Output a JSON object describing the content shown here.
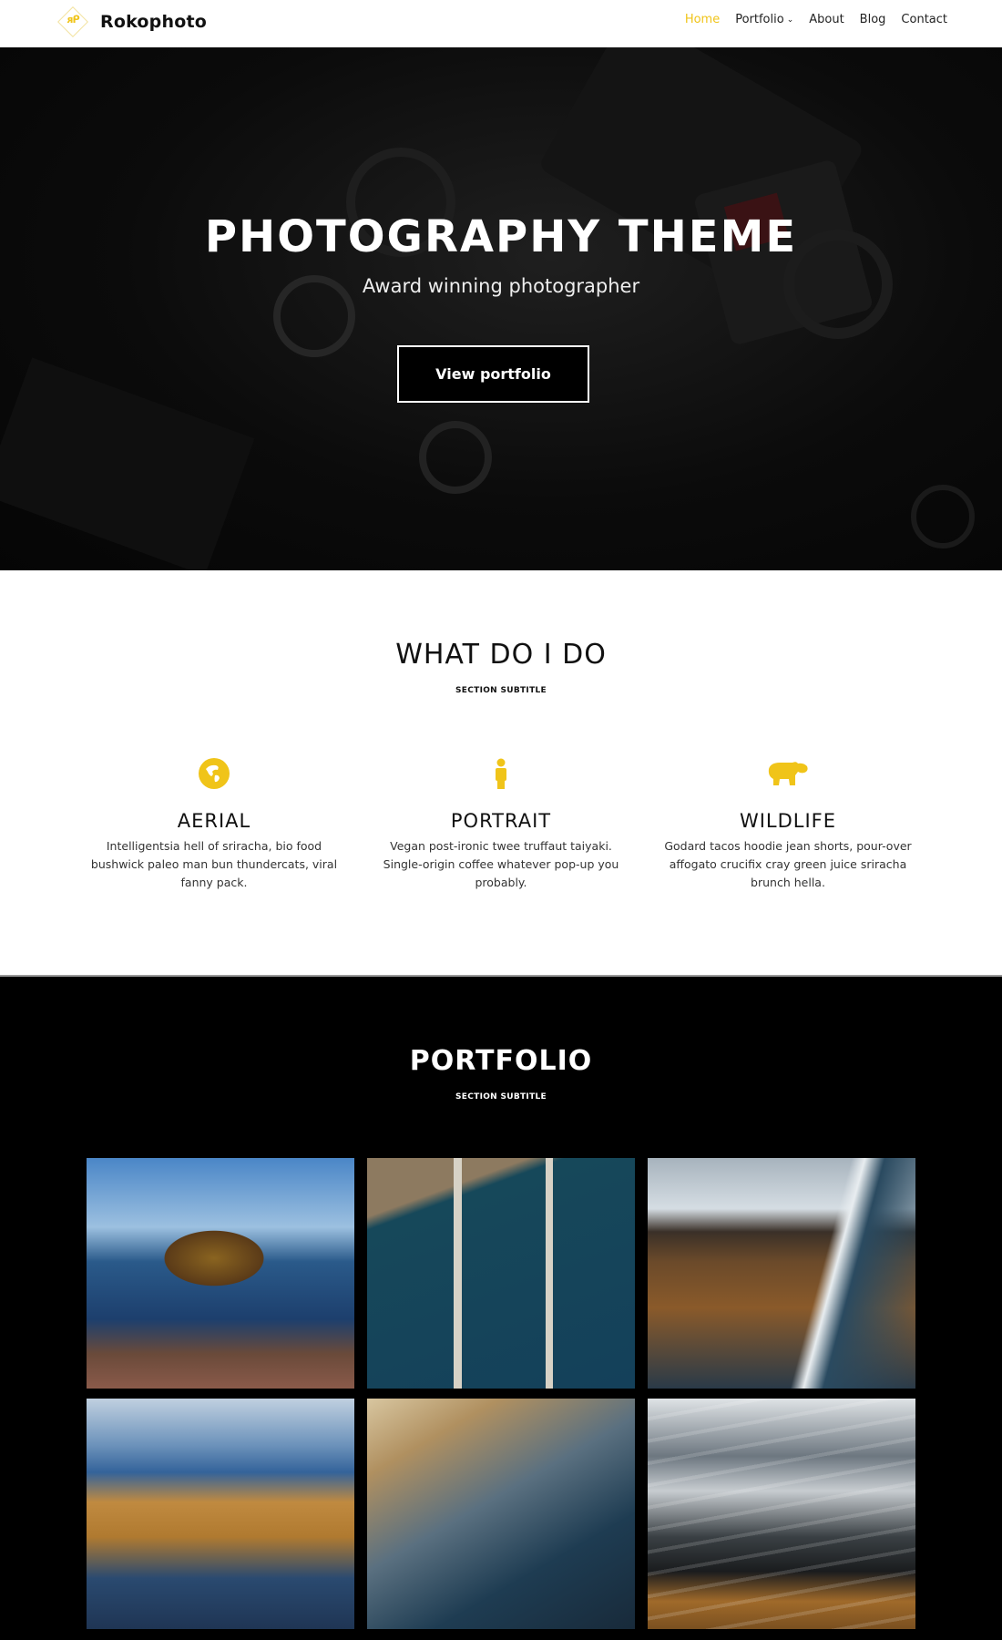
{
  "header": {
    "brand": "Rokophoto",
    "logo_glyph": "ᴙᑭ",
    "nav": [
      {
        "label": "Home",
        "active": true
      },
      {
        "label": "Portfolio",
        "has_dropdown": true
      },
      {
        "label": "About"
      },
      {
        "label": "Blog"
      },
      {
        "label": "Contact"
      }
    ],
    "dropdown_icon": "›"
  },
  "hero": {
    "title": "PHOTOGRAPHY THEME",
    "subtitle": "Award winning photographer",
    "button_label": "View portfolio"
  },
  "services": {
    "title": "WHAT DO I DO",
    "subtitle": "SECTION SUBTITLE",
    "items": [
      {
        "icon": "globe-icon",
        "name": "AERIAL",
        "description": "Intelligentsia hell of sriracha, bio food bushwick paleo man bun thundercats, viral fanny pack."
      },
      {
        "icon": "person-icon",
        "name": "PORTRAIT",
        "description": "Vegan post-ironic twee truffaut taiyaki. Single-origin coffee whatever pop-up you probably."
      },
      {
        "icon": "hippo-icon",
        "name": "WILDLIFE",
        "description": "Godard tacos hoodie jean shorts, pour-over affogato crucifix cray green juice sriracha brunch hella."
      }
    ]
  },
  "portfolio": {
    "title": "PORTFOLIO",
    "subtitle": "SECTION SUBTITLE",
    "images": [
      {
        "alt": "Aerial view of mountain peninsula and town by the sea"
      },
      {
        "alt": "Aerial view of boat harbor with docked boats"
      },
      {
        "alt": "Coastal road along black sand beach with mountains"
      },
      {
        "alt": "Aerial view of fjords and golden hills"
      },
      {
        "alt": "Aerial view of harbor village and causeway"
      },
      {
        "alt": "Waves crashing on black sand beach from above"
      }
    ]
  },
  "colors": {
    "accent": "#f0c419",
    "dark": "#000000",
    "light": "#ffffff"
  }
}
